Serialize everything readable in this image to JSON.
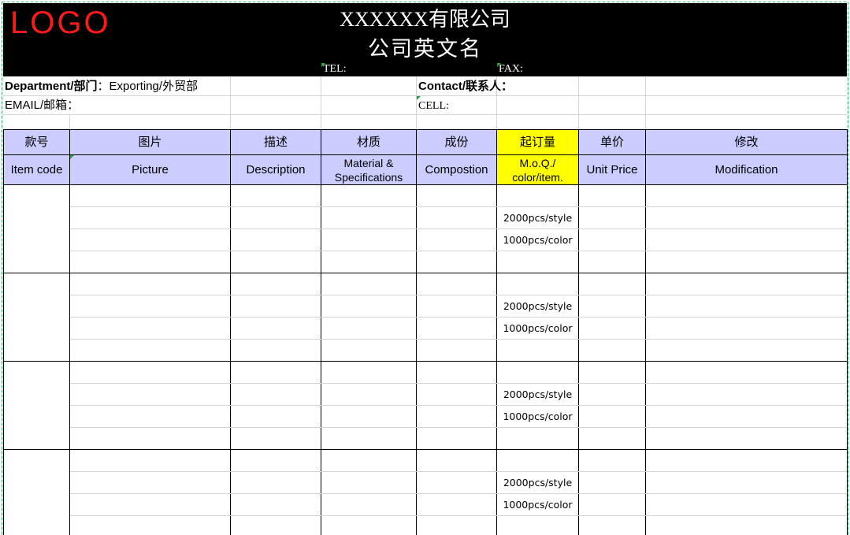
{
  "header": {
    "logo": "LOGO",
    "company_name": "XXXXXX有限公司",
    "company_english": "公司英文名",
    "tel_label": "TEL:",
    "fax_label": "FAX:"
  },
  "info": {
    "department_label": "Department/部门",
    "department_value": "：Exporting/外贸部",
    "contact_label": "Contact/联系人：",
    "email_label": "EMAIL/邮箱：",
    "cell_label": "CELL:"
  },
  "columns_cn": [
    "款号",
    "图片",
    "描述",
    "材质",
    "成份",
    "起订量",
    "单价",
    "修改"
  ],
  "columns_en": [
    "Item code",
    "Picture",
    "Description",
    "Material & Specifications",
    "Compostion",
    "M.o.Q./ color/item.",
    "Unit Price",
    "Modification"
  ],
  "rows": [
    {
      "moq_style": "2000pcs/style",
      "moq_color": "1000pcs/color"
    },
    {
      "moq_style": "2000pcs/style",
      "moq_color": "1000pcs/color"
    },
    {
      "moq_style": "2000pcs/style",
      "moq_color": "1000pcs/color"
    },
    {
      "moq_style": "2000pcs/style",
      "moq_color": "1000pcs/color"
    }
  ],
  "colors": {
    "header_band": "#000000",
    "logo": "#ff1a1a",
    "column_header": "#ccccff",
    "moq_highlight": "#ffff00"
  }
}
